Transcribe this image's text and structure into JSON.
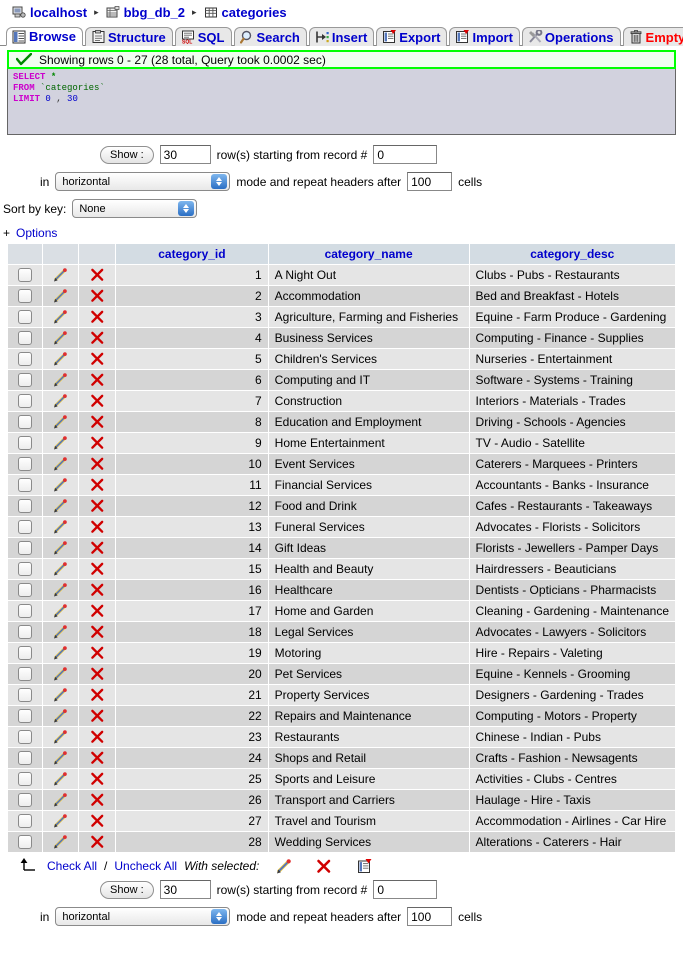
{
  "breadcrumb": {
    "server": "localhost",
    "database": "bbg_db_2",
    "table": "categories",
    "separator": "▸"
  },
  "tabs": [
    {
      "label": "Browse",
      "icon": "browse-icon",
      "active": true,
      "danger": false
    },
    {
      "label": "Structure",
      "icon": "structure-icon",
      "active": false,
      "danger": false
    },
    {
      "label": "SQL",
      "icon": "sql-icon",
      "active": false,
      "danger": false
    },
    {
      "label": "Search",
      "icon": "search-icon",
      "active": false,
      "danger": false
    },
    {
      "label": "Insert",
      "icon": "insert-icon",
      "active": false,
      "danger": false
    },
    {
      "label": "Export",
      "icon": "export-icon",
      "active": false,
      "danger": false
    },
    {
      "label": "Import",
      "icon": "import-icon",
      "active": false,
      "danger": false
    },
    {
      "label": "Operations",
      "icon": "operations-icon",
      "active": false,
      "danger": false
    },
    {
      "label": "Empty",
      "icon": "trash-icon",
      "active": false,
      "danger": true
    }
  ],
  "notice": {
    "text": "Showing rows 0 - 27 (28 total, Query took 0.0002 sec)",
    "icon": "success-check-icon",
    "border_color": "#00FF00"
  },
  "sql": {
    "keyword_select": "SELECT",
    "asterisk": "*",
    "keyword_from": "FROM",
    "table_quoted": "`categories`",
    "keyword_limit": "LIMIT",
    "limit_offset": "0",
    "limit_comma": ",",
    "limit_count": "30"
  },
  "controls_top": {
    "show_button": "Show :",
    "rows_value": "30",
    "rows_label": "row(s) starting from record #",
    "record_value": "0",
    "in_label": "in",
    "mode_value": "horizontal",
    "mode_label": "mode and repeat headers after",
    "cells_value": "100",
    "cells_label": "cells",
    "sort_label": "Sort by key:",
    "sort_value": "None",
    "options_plus": "+",
    "options_label": "Options"
  },
  "table": {
    "columns": [
      "category_id",
      "category_name",
      "category_desc"
    ],
    "rows": [
      {
        "id": "1",
        "name": "A Night Out",
        "desc": "Clubs - Pubs - Restaurants"
      },
      {
        "id": "2",
        "name": "Accommodation",
        "desc": "Bed and Breakfast - Hotels"
      },
      {
        "id": "3",
        "name": "Agriculture, Farming and Fisheries",
        "desc": "Equine - Farm Produce - Gardening"
      },
      {
        "id": "4",
        "name": "Business Services",
        "desc": "Computing - Finance - Supplies"
      },
      {
        "id": "5",
        "name": "Children's Services",
        "desc": "Nurseries - Entertainment"
      },
      {
        "id": "6",
        "name": "Computing and IT",
        "desc": "Software - Systems - Training"
      },
      {
        "id": "7",
        "name": "Construction",
        "desc": "Interiors - Materials - Trades"
      },
      {
        "id": "8",
        "name": "Education and Employment",
        "desc": "Driving - Schools - Agencies"
      },
      {
        "id": "9",
        "name": "Home Entertainment",
        "desc": "TV - Audio - Satellite"
      },
      {
        "id": "10",
        "name": "Event Services",
        "desc": "Caterers - Marquees - Printers"
      },
      {
        "id": "11",
        "name": "Financial Services",
        "desc": "Accountants - Banks - Insurance"
      },
      {
        "id": "12",
        "name": "Food and Drink",
        "desc": "Cafes - Restaurants - Takeaways"
      },
      {
        "id": "13",
        "name": "Funeral Services",
        "desc": "Advocates - Florists - Solicitors"
      },
      {
        "id": "14",
        "name": "Gift Ideas",
        "desc": "Florists - Jewellers - Pamper Days"
      },
      {
        "id": "15",
        "name": "Health and Beauty",
        "desc": "Hairdressers - Beauticians"
      },
      {
        "id": "16",
        "name": "Healthcare",
        "desc": "Dentists - Opticians - Pharmacists"
      },
      {
        "id": "17",
        "name": "Home and Garden",
        "desc": "Cleaning - Gardening - Maintenance"
      },
      {
        "id": "18",
        "name": "Legal Services",
        "desc": "Advocates - Lawyers - Solicitors"
      },
      {
        "id": "19",
        "name": "Motoring",
        "desc": "Hire - Repairs - Valeting"
      },
      {
        "id": "20",
        "name": "Pet Services",
        "desc": "Equine - Kennels - Grooming"
      },
      {
        "id": "21",
        "name": "Property Services",
        "desc": "Designers - Gardening - Trades"
      },
      {
        "id": "22",
        "name": "Repairs and Maintenance",
        "desc": "Computing - Motors - Property"
      },
      {
        "id": "23",
        "name": "Restaurants",
        "desc": "Chinese - Indian - Pubs"
      },
      {
        "id": "24",
        "name": "Shops and Retail",
        "desc": "Crafts - Fashion - Newsagents"
      },
      {
        "id": "25",
        "name": "Sports and Leisure",
        "desc": "Activities - Clubs - Centres"
      },
      {
        "id": "26",
        "name": "Transport and Carriers",
        "desc": "Haulage - Hire - Taxis"
      },
      {
        "id": "27",
        "name": "Travel and Tourism",
        "desc": "Accommodation - Airlines - Car Hire"
      },
      {
        "id": "28",
        "name": "Wedding Services",
        "desc": "Alterations - Caterers - Hair"
      }
    ]
  },
  "footer_actions": {
    "check_all": "Check All",
    "slash": "/",
    "uncheck_all": "Uncheck All",
    "with_selected": "With selected:"
  },
  "controls_bottom": {
    "show_button": "Show :",
    "rows_value": "30",
    "rows_label": "row(s) starting from record #",
    "record_value": "0",
    "in_label": "in",
    "mode_value": "horizontal",
    "mode_label": "mode and repeat headers after",
    "cells_value": "100",
    "cells_label": "cells"
  },
  "colors": {
    "link": "#0000CC",
    "danger": "#FF0000",
    "header_bg": "#D3DCE3",
    "row_odd": "#E5E5E5",
    "row_even": "#D5D5D5",
    "notice_border": "#00FF00"
  }
}
